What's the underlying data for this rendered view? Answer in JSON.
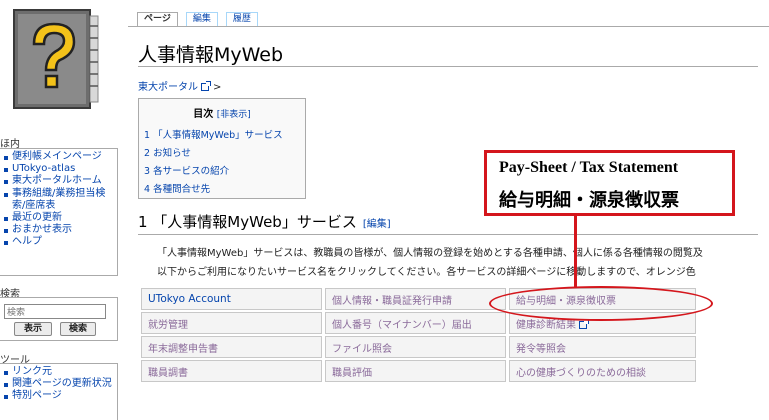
{
  "sidebar": {
    "nav_heading": "ほ内",
    "nav_items": [
      "便利帳メインページ",
      "UTokyo-atlas",
      "東大ポータルホーム",
      "事務組織/業務担当検索/座席表",
      "最近の更新",
      "おまかせ表示",
      "ヘルプ"
    ],
    "search_heading": "検索",
    "search_placeholder": "検索",
    "search_button": "表示",
    "find_button": "検索",
    "tools_heading": "ツール",
    "tools_items": [
      "リンク元",
      "関連ページの更新状況",
      "特別ページ"
    ]
  },
  "tabs": [
    "ページ",
    "編集",
    "履歴"
  ],
  "page": {
    "title": "人事情報MyWeb",
    "breadcrumb_link": "東大ポータル",
    "breadcrumb_sep": ">",
    "toc_title": "目次",
    "toc_toggle": "[非表示]",
    "toc_items": [
      "1 「人事情報MyWeb」サービス",
      "2 お知らせ",
      "3 各サービスの紹介",
      "4 各種問合せ先"
    ],
    "section_heading": "1 「人事情報MyWeb」サービス",
    "section_edit": "[編集]",
    "intro_line1": "「人事情報MyWeb」サービスは、教職員の皆様が、個人情報の登録を始めとする各種申請、個人に係る各種情報の閲覧及",
    "intro_line2": "以下からご利用になりたいサービス名をクリックしてください。各サービスの詳細ページに移動しますので、オレンジ色"
  },
  "services": [
    [
      "UTokyo Account",
      "個人情報・職員証発行申請",
      "給与明細・源泉徴収票"
    ],
    [
      "就労管理",
      "個人番号（マイナンバー）届出",
      "健康診断結果"
    ],
    [
      "年末調整申告書",
      "ファイル照会",
      "発令等照会"
    ],
    [
      "職員調書",
      "職員評価",
      "心の健康づくりのための相談"
    ]
  ],
  "annotation": {
    "english": "Pay-Sheet / Tax Statement",
    "japanese": "給与明細・源泉徴収票",
    "color": "#d4161c"
  }
}
